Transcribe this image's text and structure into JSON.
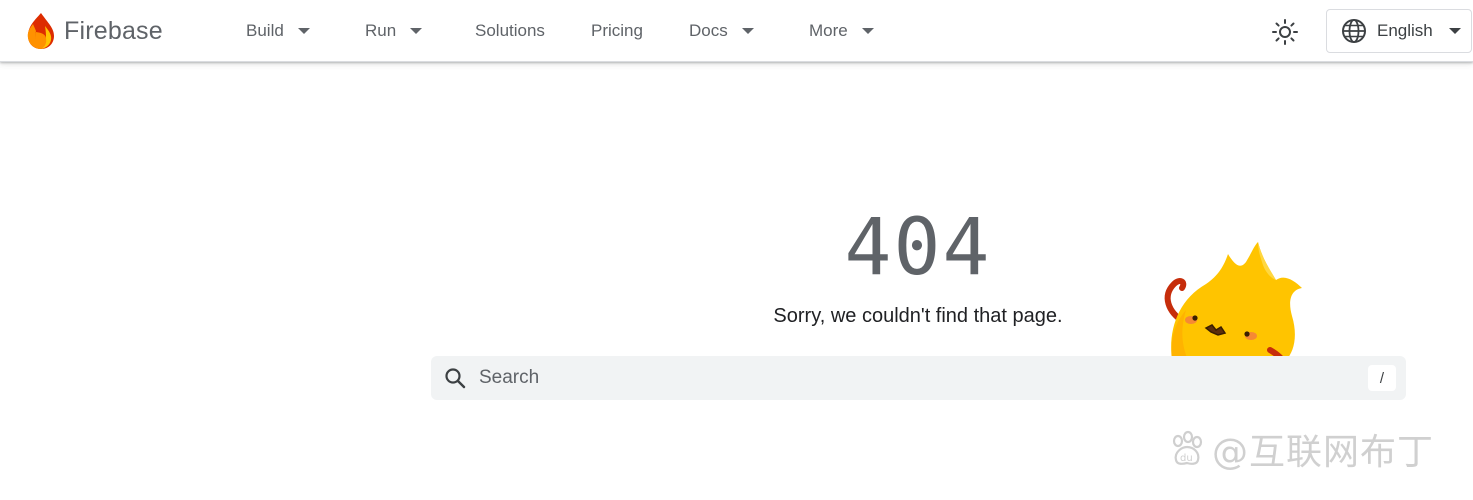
{
  "header": {
    "brand": "Firebase",
    "nav": [
      {
        "label": "Build",
        "has_menu": true
      },
      {
        "label": "Run",
        "has_menu": true
      },
      {
        "label": "Solutions",
        "has_menu": false
      },
      {
        "label": "Pricing",
        "has_menu": false
      },
      {
        "label": "Docs",
        "has_menu": true
      },
      {
        "label": "More",
        "has_menu": true
      }
    ],
    "theme_icon": "sun-icon",
    "language": {
      "label": "English",
      "icon": "globe-icon"
    }
  },
  "error": {
    "code": "404",
    "message": "Sorry, we couldn't find that page."
  },
  "search": {
    "placeholder": "Search",
    "shortcut": "/"
  },
  "watermark": {
    "text": "@互联网布丁"
  },
  "colors": {
    "text_gray": "#5f6368",
    "search_bg": "#f1f3f4",
    "mascot_yellow": "#ffc400",
    "mascot_red": "#c62d0b"
  }
}
